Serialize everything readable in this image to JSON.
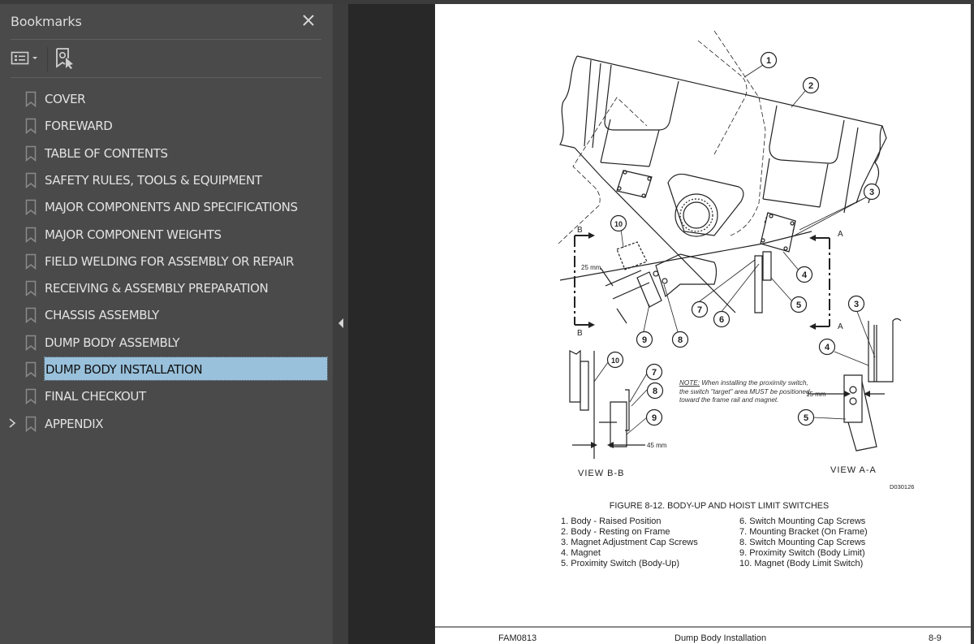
{
  "panel": {
    "title": "Bookmarks",
    "close_icon": "close-icon",
    "toolbar": {
      "options_icon": "list-options-icon",
      "find_bookmark_icon": "find-current-bookmark-icon"
    },
    "collapse_icon": "collapse-left-icon"
  },
  "bookmarks": [
    {
      "label": "COVER",
      "selected": false,
      "expandable": false
    },
    {
      "label": "FOREWARD",
      "selected": false,
      "expandable": false
    },
    {
      "label": "TABLE OF CONTENTS",
      "selected": false,
      "expandable": false
    },
    {
      "label": "SAFETY RULES, TOOLS & EQUIPMENT",
      "selected": false,
      "expandable": false
    },
    {
      "label": "MAJOR COMPONENTS AND SPECIFICATIONS",
      "selected": false,
      "expandable": false
    },
    {
      "label": "MAJOR COMPONENT WEIGHTS",
      "selected": false,
      "expandable": false
    },
    {
      "label": "FIELD WELDING FOR ASSEMBLY OR REPAIR",
      "selected": false,
      "expandable": false
    },
    {
      "label": "RECEIVING & ASSEMBLY PREPARATION",
      "selected": false,
      "expandable": false
    },
    {
      "label": "CHASSIS ASSEMBLY",
      "selected": false,
      "expandable": false
    },
    {
      "label": "DUMP BODY ASSEMBLY",
      "selected": false,
      "expandable": false
    },
    {
      "label": "DUMP BODY INSTALLATION",
      "selected": true,
      "expandable": false
    },
    {
      "label": "FINAL CHECKOUT",
      "selected": false,
      "expandable": false
    },
    {
      "label": "APPENDIX",
      "selected": false,
      "expandable": true
    }
  ],
  "document": {
    "figure": {
      "title": "FIGURE 8-12. BODY-UP AND HOIST LIMIT SWITCHES",
      "drawing_id": "D030126",
      "view_bb": "VIEW  B-B",
      "view_aa": "VIEW   A-A",
      "dim_25": "25 mm",
      "dim_45": "45 mm",
      "dim_15": "15 mm",
      "section_b": "B",
      "section_a": "A",
      "note_label": "NOTE:",
      "note_text": " When installing the proximity switch, the switch \"target\" area MUST be positioned toward the frame rail and magnet.",
      "callouts": [
        "1",
        "2",
        "3",
        "4",
        "5",
        "6",
        "7",
        "8",
        "9",
        "10"
      ],
      "legend_left": [
        "1. Body - Raised Position",
        "2. Body - Resting on Frame",
        "3. Magnet Adjustment Cap Screws",
        "4. Magnet",
        "5. Proximity Switch (Body-Up)"
      ],
      "legend_right": [
        "6. Switch Mounting Cap Screws",
        "7. Mounting Bracket (On Frame)",
        "8. Switch Mounting Cap Screws",
        "9. Proximity Switch (Body Limit)",
        "10. Magnet (Body Limit Switch)"
      ]
    },
    "footer": {
      "doc_id": "FAM0813",
      "section": "Dump Body Installation",
      "page": "8-9"
    }
  }
}
